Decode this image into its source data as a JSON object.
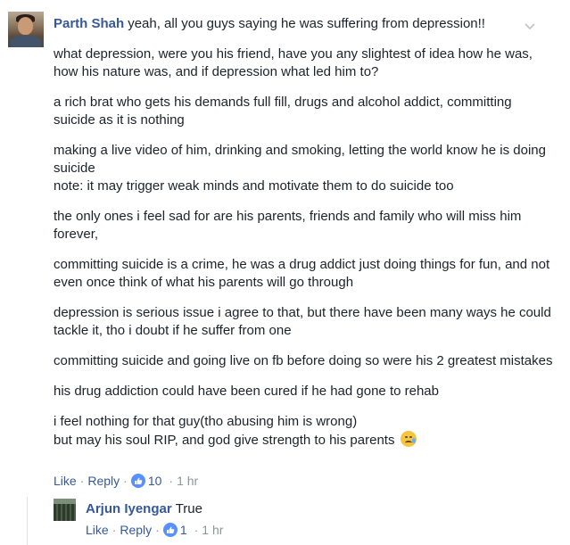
{
  "comment": {
    "author": "Parth Shah",
    "first_line": "yeah, all you guys saying he was suffering from depression!!",
    "paragraphs": [
      "what depression, were you his friend, have you any slightest of idea how he was, how his nature was, and if depression what led him to?",
      "a rich brat who gets his demands full fill, drugs and alcohol addict, committing suicide as it is nothing",
      "making a live video of him, drinking and smoking, letting the world know he is doing suicide",
      "the only ones i feel sad for are his parents, friends and family who will miss him forever,",
      "committing suicide is a crime, he was a drug addict just doing things for fun, and not even once think of what his parents will go through",
      "depression is serious issue i agree to that, but there have been many ways he could tackle it, tho i doubt if he suffer from one",
      "committing suicide and going live on fb before doing so were his 2 greatest mistakes",
      "his drug addiction could have been cured if he had gone to rehab",
      "i feel nothing for that guy(tho abusing him is wrong)"
    ],
    "note_line": "note: it may trigger weak minds and motivate them to do suicide too",
    "last_line": "but may his soul RIP, and god give strength to his parents",
    "emoji": "crying-face-emoji",
    "like_label": "Like",
    "reply_label": "Reply",
    "reaction_count": "10",
    "time": "1 hr",
    "separator": "·"
  },
  "reply": {
    "author": "Arjun Iyengar",
    "text": "True",
    "like_label": "Like",
    "reply_label": "Reply",
    "reaction_count": "1",
    "time": "1 hr",
    "separator": "·"
  },
  "colors": {
    "link": "#365899",
    "meta": "#90949c",
    "text": "#1d2129",
    "reaction": "#5890ff"
  },
  "icons": {
    "options": "chevron-down-icon",
    "reaction": "like-reaction-icon"
  }
}
